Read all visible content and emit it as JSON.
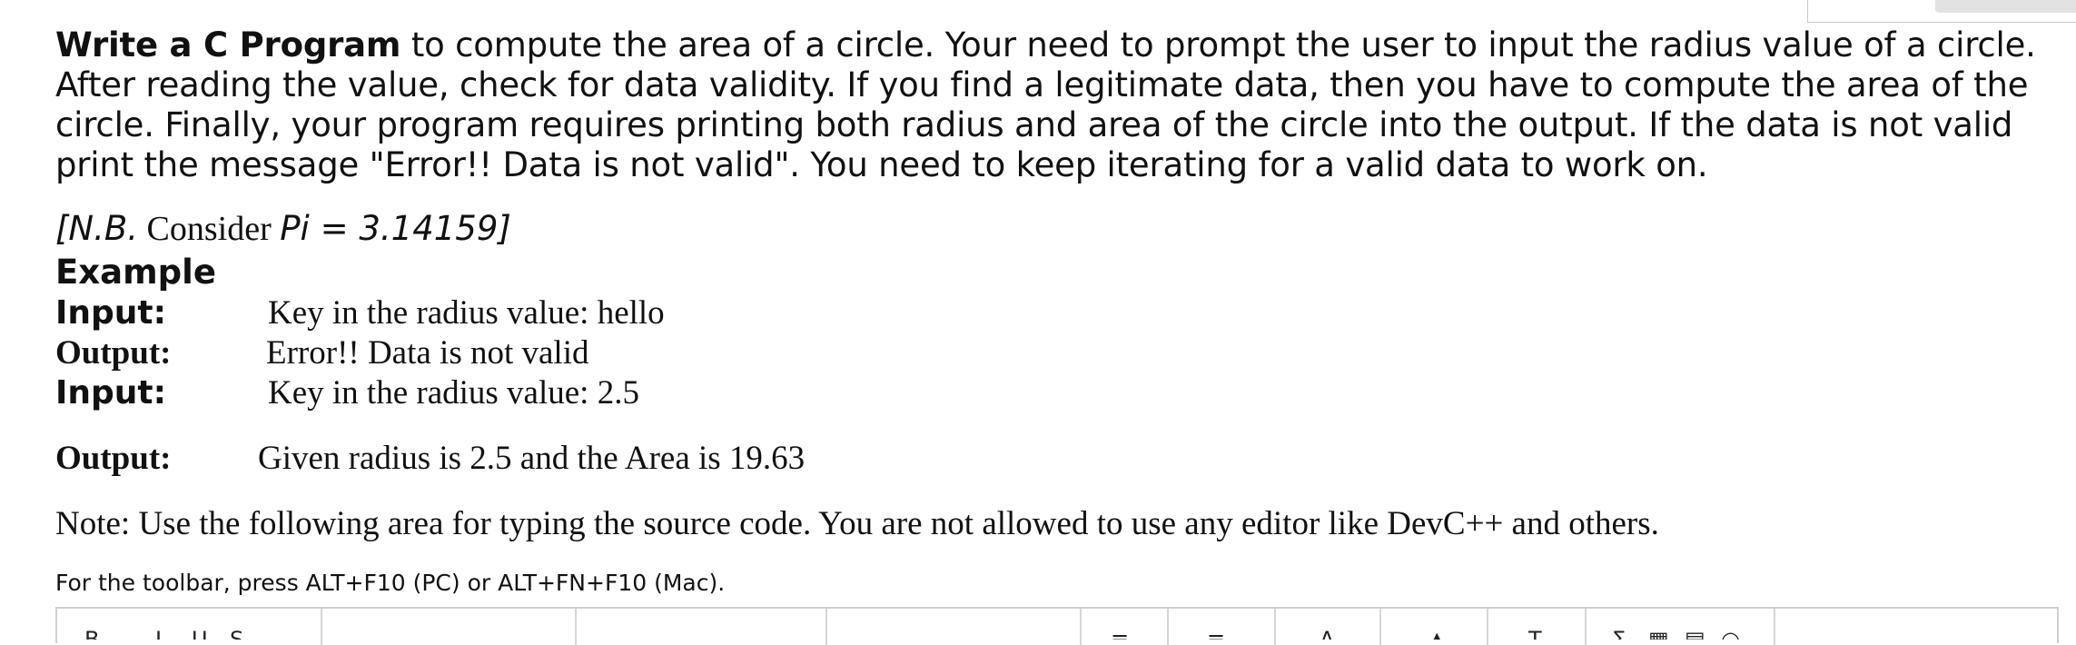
{
  "question": {
    "intro_bold": "Write a C Program",
    "intro_rest": " to compute the area of a circle. Your need to prompt the user to input the radius value of a circle. After reading the value, check for data validity. If you find a legitimate data, then you have to compute the area of the circle. Finally, your program requires printing both radius and area of the circle into the output. If the data is not valid print the message \"Error!! Data is not valid\". You need to keep iterating for a valid data to work on.",
    "nb_open": "[N.B.",
    "nb_consider": " Consider ",
    "nb_pi": "Pi = 3.14159]",
    "example_heading": "Example",
    "io": [
      {
        "label": "Input:",
        "value": "Key in the radius value: hello"
      },
      {
        "label": "Output:",
        "value": "Error!! Data is not valid"
      },
      {
        "label": "Input:",
        "value": "Key in the radius value: 2.5"
      },
      {
        "label": "Output:",
        "value": "Given radius is 2.5 and the Area is 19.63"
      }
    ],
    "note": "Note: Use the following area for typing the source code. You are not allowed to use any editor like DevC++ and others."
  },
  "editor": {
    "toolbar_hint": "For the toolbar, press ALT+F10 (PC) or ALT+FN+F10 (Mac).",
    "toolbar_icons": [
      "bold-icon",
      "italic-icon",
      "underline-icon",
      "strikethrough-icon",
      "font-family-dropdown",
      "font-size-dropdown",
      "paragraph-dropdown",
      "bullet-list-icon",
      "numbered-list-icon",
      "text-color-icon",
      "highlight-icon",
      "clear-formatting-icon",
      "function-icon",
      "table-icon",
      "paste-icon",
      "help-icon"
    ]
  }
}
